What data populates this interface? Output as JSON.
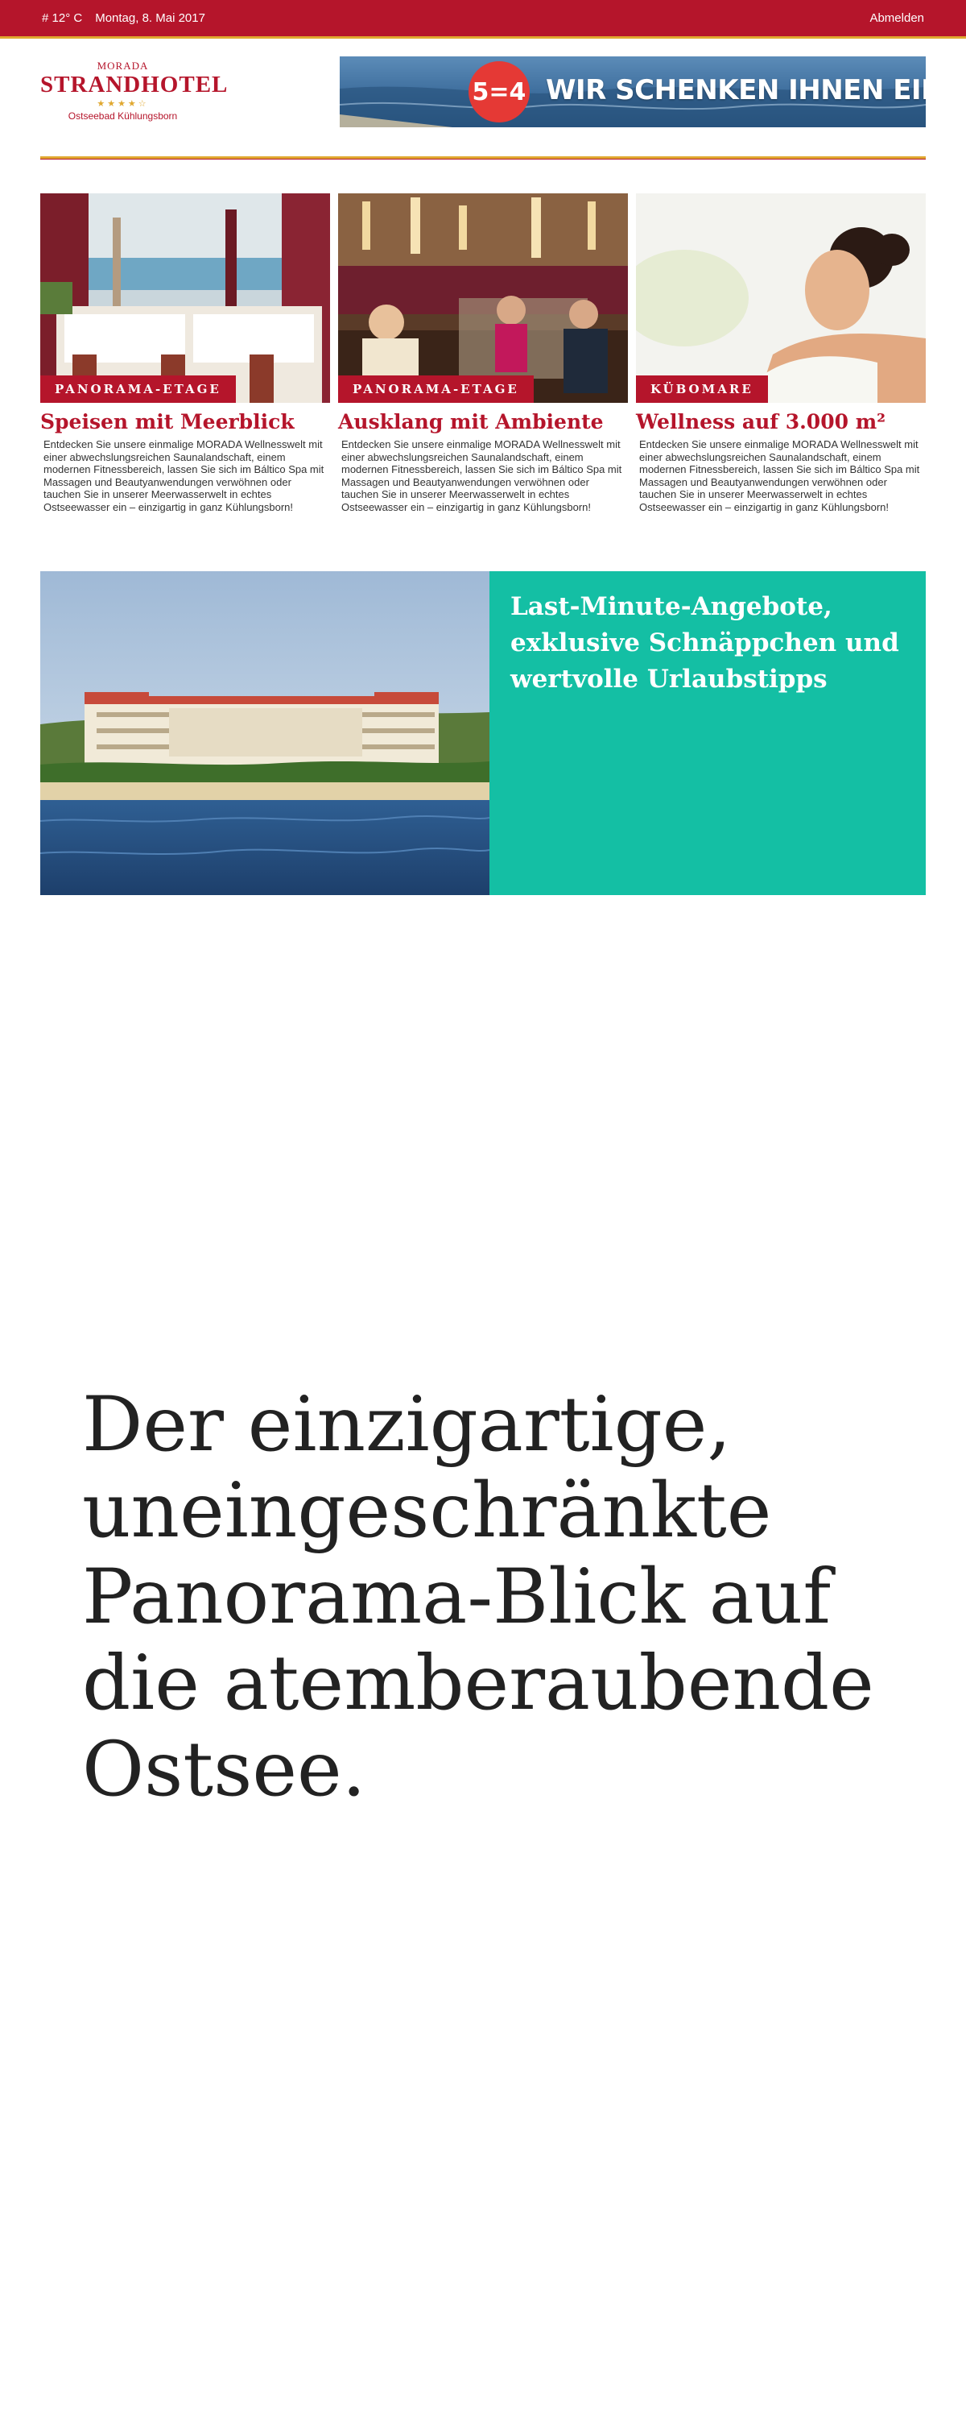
{
  "topbar": {
    "weather": "# 12° C",
    "date": "Montag, 8. Mai 2017",
    "logout": "Abmelden"
  },
  "logo": {
    "brand": "MORADA",
    "name": "STRANDHOTEL",
    "stars": "★★★★☆",
    "location": "Ostseebad Kühlungsborn"
  },
  "banner": {
    "badge": "5=4",
    "slogan": "WIR SCHENKEN IHNEN EINE NACHT!"
  },
  "cards": [
    {
      "tag": "PANORAMA-ETAGE",
      "title": "Speisen mit Meerblick",
      "text": "Entdecken Sie unsere einmalige MORADA Wellnesswelt mit einer abwechslungsreichen Saunalandschaft, einem modernen Fitnessbereich, lassen Sie sich im Báltico Spa mit Massagen und Beautyanwendungen verwöhnen oder tauchen Sie in unserer Meerwasserwelt in echtes Ostseewasser ein – einzigartig in ganz Kühlungsborn!"
    },
    {
      "tag": "PANORAMA-ETAGE",
      "title": "Ausklang mit Ambiente",
      "text": "Entdecken Sie unsere einmalige MORADA Wellnesswelt mit einer abwechslungsreichen Saunalandschaft, einem modernen Fitnessbereich, lassen Sie sich im Báltico Spa mit Massagen und Beautyanwendungen verwöhnen oder tauchen Sie in unserer Meerwasserwelt in echtes Ostseewasser ein – einzigartig in ganz Kühlungsborn!"
    },
    {
      "tag": "KÜBOMARE",
      "title": "Wellness auf 3.000 m²",
      "text": "Entdecken Sie unsere einmalige MORADA Wellnesswelt mit einer abwechslungsreichen Saunalandschaft, einem modernen Fitnessbereich, lassen Sie sich im Báltico Spa mit Massagen und Beautyanwendungen verwöhnen oder tauchen Sie in unserer Meerwasserwelt in echtes Ostseewasser ein – einzigartig in ganz Kühlungsborn!"
    }
  ],
  "promo": {
    "title": "Last-Minute-Angebote, exklusive Schnäppchen und wertvolle Urlaubstipps"
  },
  "hero": {
    "text": "Der einzigartige, uneingeschränkte Panorama-Blick auf die atemberaubende Ostsee."
  },
  "colors": {
    "brand_red": "#b5152b",
    "gold": "#e0a830",
    "teal": "#14bfa4"
  }
}
